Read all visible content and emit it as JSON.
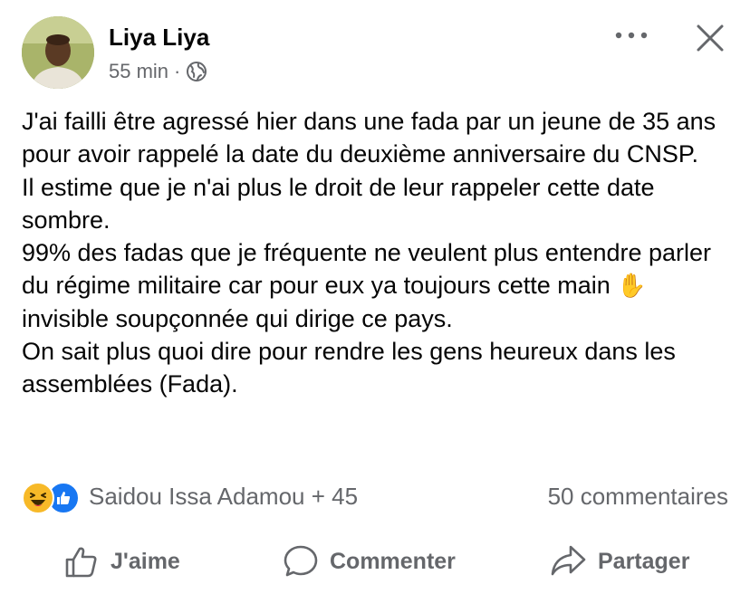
{
  "post": {
    "author": "Liya Liya",
    "time": "55 min",
    "separator": "·",
    "visibility_icon": "globe-icon",
    "menu_icon": "more-horizontal-icon",
    "close_icon": "close-icon"
  },
  "body": {
    "lines": [
      "J'ai failli être agressé hier dans une fada par un jeune de 35 ans  pour avoir rappelé la date du deuxième anniversaire du CNSP.",
      "Il estime que je n'ai plus le droit de leur rappeler cette date sombre."
    ],
    "line3_before": "99% des fadas que je fréquente ne veulent plus entendre parler du régime militaire car pour eux ya toujours cette main",
    "line3_emoji": "✋",
    "line3_after": "invisible soupçonnée qui dirige ce pays.",
    "line4": "On sait plus quoi dire pour rendre les gens heureux dans les assemblées (Fada)."
  },
  "reactions": {
    "icons": [
      "haha-icon",
      "like-icon"
    ],
    "summary": "Saidou Issa Adamou + 45",
    "comments": "50 commentaires"
  },
  "actions": {
    "like_label": "J'aime",
    "comment_label": "Commenter",
    "share_label": "Partager"
  },
  "colors": {
    "text": "#050505",
    "secondary": "#65676b",
    "like_blue": "#1877f2",
    "haha_yellow": "#f7b928"
  }
}
